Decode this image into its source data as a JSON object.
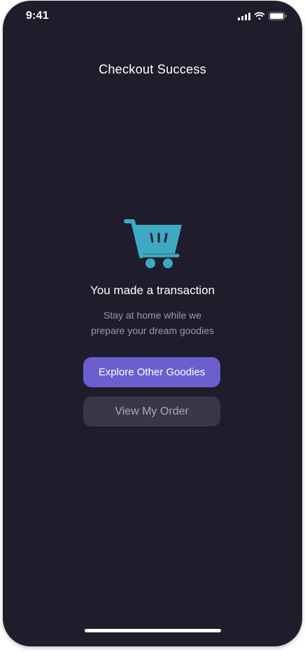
{
  "status_bar": {
    "time": "9:41"
  },
  "header": {
    "title": "Checkout Success"
  },
  "illustration": {
    "icon": "shopping-cart-icon",
    "color": "#3DA9C2"
  },
  "message": {
    "headline": "You made a transaction",
    "subtext_line1": "Stay at home while we",
    "subtext_line2": "prepare your dream goodies"
  },
  "actions": {
    "primary_label": "Explore Other Goodies",
    "secondary_label": "View My Order"
  },
  "colors": {
    "background": "#1F1D2B",
    "primary": "#6C5ECF",
    "secondary": "#393848",
    "muted_text": "#9B9AA6",
    "accent": "#3DA9C2"
  }
}
